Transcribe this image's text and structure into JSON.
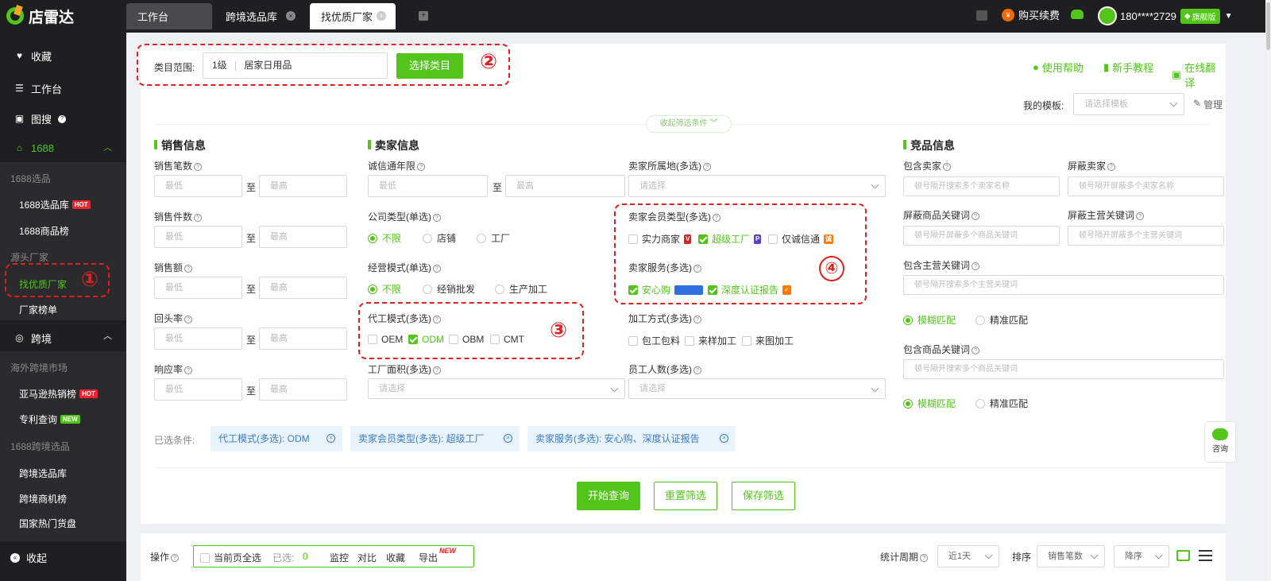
{
  "app": {
    "name": "店雷达"
  },
  "tabs": [
    {
      "label": "工作台"
    },
    {
      "label": "跨境选品库"
    },
    {
      "label": "找优质厂家"
    }
  ],
  "topbar": {
    "renew": "购买续费",
    "user": "180****2729",
    "vip": "旗舰版"
  },
  "sidebar": {
    "favorites": "收藏",
    "workbench": "工作台",
    "image_search": "图搜",
    "group_1688": "1688",
    "sub_1688_title": "1688选品",
    "item_1688_lib": "1688选品库",
    "item_1688_rank": "1688商品榜",
    "source_title": "源头厂家",
    "item_find_factory": "找优质厂家",
    "item_factory_rank": "厂家榜单",
    "group_cross": "跨境",
    "overseas_title": "海外跨境市场",
    "item_amazon": "亚马逊热销榜",
    "item_patent": "专利查询",
    "cross1688_title": "1688跨境选品",
    "item_cross_lib": "跨境选品库",
    "item_cross_opp": "跨境商机榜",
    "item_hot_goods": "国家热门货盘",
    "collapse": "收起",
    "hot": "HOT",
    "new": "NEW"
  },
  "category": {
    "label": "类目范围:",
    "level": "1级",
    "value": "居家日用品",
    "button": "选择类目"
  },
  "help": {
    "usage": "使用帮助",
    "tutorial": "新手教程",
    "translate": "在线翻译"
  },
  "template": {
    "label": "我的模板:",
    "placeholder": "请选择模板",
    "manage": "管理"
  },
  "collapse_filter": "收起筛选条件",
  "sales": {
    "title": "销售信息",
    "count": "销售笔数",
    "pieces": "销售件数",
    "amount": "销售额",
    "repurchase": "回头率",
    "response": "响应率",
    "min": "最低",
    "max": "最高",
    "to": "至"
  },
  "seller": {
    "title": "卖家信息",
    "years": "诚信通年限",
    "company_type": "公司类型(单选)",
    "company_opts": [
      "不限",
      "店铺",
      "工厂"
    ],
    "biz_mode": "经营模式(单选)",
    "biz_opts": [
      "不限",
      "经销批发",
      "生产加工"
    ],
    "oem_mode": "代工模式(多选)",
    "oem_opts": [
      "OEM",
      "ODM",
      "OBM",
      "CMT"
    ],
    "factory_area": "工厂面积(多选)",
    "location": "卖家所属地(多选)",
    "member_type": "卖家会员类型(多选)",
    "member_opts": [
      "实力商家",
      "超级工厂",
      "仅诚信通"
    ],
    "services": "卖家服务(多选)",
    "service_opts": [
      "安心购",
      "深度认证报告"
    ],
    "processing": "加工方式(多选)",
    "processing_opts": [
      "包工包料",
      "来样加工",
      "来图加工"
    ],
    "staff": "员工人数(多选)",
    "please_select": "请选择"
  },
  "competitor": {
    "title": "竞品信息",
    "include_seller": "包含卖家",
    "block_seller": "屏蔽卖家",
    "include_seller_ph": "顿号隔开搜索多个卖家名称",
    "block_seller_ph": "顿号隔开屏蔽多个卖家名称",
    "block_kw": "屏蔽商品关键词",
    "block_kw_ph": "顿号隔开屏蔽多个商品关键词",
    "block_main_kw": "屏蔽主营关键词",
    "block_main_kw_ph": "顿号隔开屏蔽多个主营关键词",
    "include_main_kw": "包含主营关键词",
    "include_main_kw_ph": "顿号隔开搜索多个主营关键词",
    "fuzzy": "模糊匹配",
    "exact": "精准匹配",
    "include_kw": "包含商品关键词",
    "include_kw_ph": "顿号隔开搜索多个商品关键词"
  },
  "selected": {
    "label": "已选条件:",
    "tags": [
      "代工模式(多选): ODM",
      "卖家会员类型(多选): 超级工厂",
      "卖家服务(多选): 安心购、深度认证报告"
    ]
  },
  "actions": {
    "query": "开始查询",
    "reset": "重置筛选",
    "save": "保存筛选"
  },
  "consult": "咨询",
  "bottom": {
    "ops": "操作",
    "select_page": "当前页全选",
    "selected_label": "已选:",
    "selected_count": "0",
    "monitor": "监控",
    "compare": "对比",
    "collect": "收藏",
    "export": "导出",
    "export_badge": "NEW",
    "period_label": "统计周期",
    "period_value": "近1天",
    "sort_label": "排序",
    "sort_field": "销售笔数",
    "sort_order": "降序"
  },
  "annotations": [
    "①",
    "②",
    "③",
    "④"
  ],
  "colors": {
    "accent": "#52c41a",
    "annotation": "#e02020",
    "sidebar_bg": "#1f1f21"
  }
}
